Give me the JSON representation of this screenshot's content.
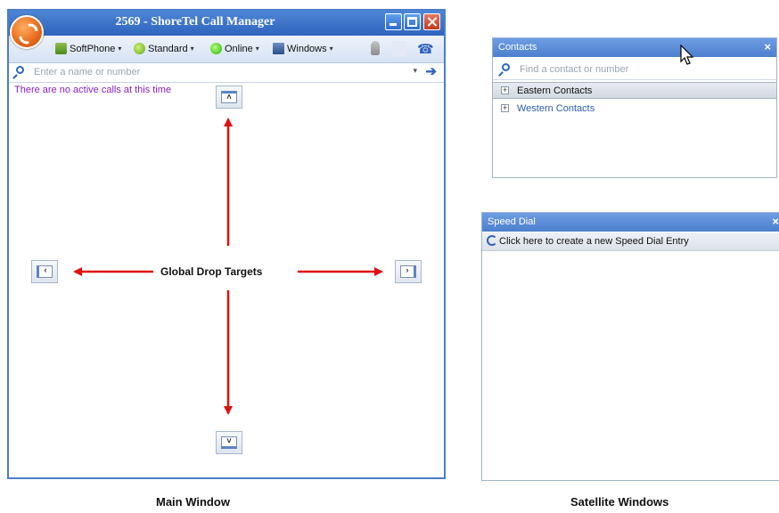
{
  "main_window": {
    "title": "2569 - ShoreTel Call Manager",
    "toolbar": {
      "softphone_label": "SoftPhone",
      "standard_label": "Standard",
      "online_label": "Online",
      "windows_label": "Windows",
      "caret": "▾"
    },
    "search": {
      "placeholder": "Enter a name or number"
    },
    "status_text": "There are no active calls at this time",
    "drop_label": "Global Drop Targets",
    "drop_glyphs": {
      "top": "˄",
      "left": "‹",
      "right": "›",
      "bottom": "˅"
    }
  },
  "contacts_window": {
    "title": "Contacts",
    "close": "×",
    "search_placeholder": "Find a contact or number",
    "groups": [
      {
        "label": "Eastern Contacts",
        "expander": "+"
      },
      {
        "label": "Western Contacts",
        "expander": "+"
      }
    ]
  },
  "speeddial_window": {
    "title": "Speed Dial",
    "close": "×",
    "create_label": "Click here to create a new Speed Dial Entry"
  },
  "captions": {
    "main": "Main Window",
    "satellite": "Satellite Windows"
  },
  "colors": {
    "titlebar": "#2f64be",
    "status_text": "#8a1fbd",
    "arrow": "#e01010"
  }
}
